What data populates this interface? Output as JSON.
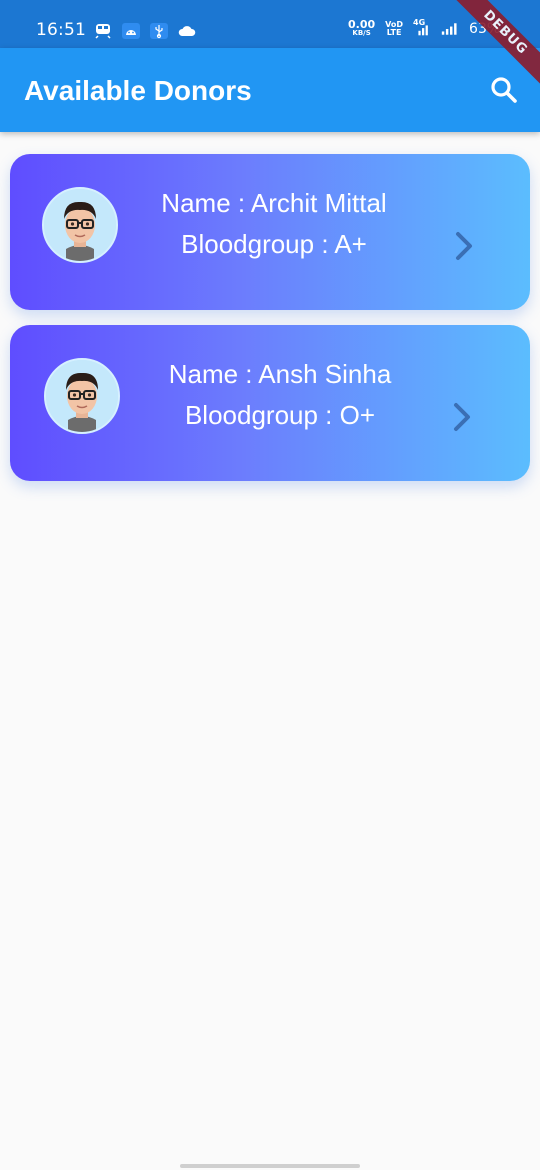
{
  "status_bar": {
    "time": "16:51",
    "net_speed_value": "0.00",
    "net_speed_unit": "KB/S",
    "volte_top": "VoD",
    "volte_bottom": "LTE",
    "network_type": "4G",
    "battery_percent": "63%",
    "icons": [
      "train-icon",
      "android-icon",
      "usb-icon",
      "cloud-icon",
      "signal-icon",
      "wifi-call-icon",
      "battery-icon"
    ]
  },
  "debug_banner": "DEBUG",
  "app_bar": {
    "title": "Available Donors",
    "search_icon": "search-icon"
  },
  "donors": [
    {
      "name_line": "Name : Archit Mittal",
      "blood_line": "Bloodgroup : A+"
    },
    {
      "name_line": "Name : Ansh Sinha",
      "blood_line": "Bloodgroup : O+"
    }
  ],
  "colors": {
    "status_bar": "#1c77d2",
    "app_bar": "#2196f3",
    "card_gradient_start": "#5f4dff",
    "card_gradient_end": "#5bbdfe",
    "chevron": "#3a6fb5",
    "background": "#fafafa"
  }
}
